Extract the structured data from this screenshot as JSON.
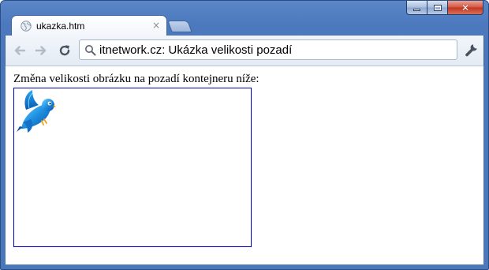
{
  "tab": {
    "title": "ukazka.htm",
    "close_symbol": "×",
    "favicon": "globe-icon"
  },
  "toolbar": {
    "back_icon": "back-arrow-icon",
    "forward_icon": "forward-arrow-icon",
    "reload_icon": "reload-icon",
    "omnibox_text": "itnetwork.cz: Ukázka velikosti pozadí",
    "omnibox_icon": "search-icon",
    "menu_icon": "wrench-icon"
  },
  "window_controls": {
    "close_symbol": "✕"
  },
  "page": {
    "heading_text": "Změna velikosti obrázku na pozadí kontejneru níže:",
    "background_image": "bluebird-image"
  },
  "colors": {
    "frame": "#4a76ba",
    "container_border": "#0000cc"
  }
}
